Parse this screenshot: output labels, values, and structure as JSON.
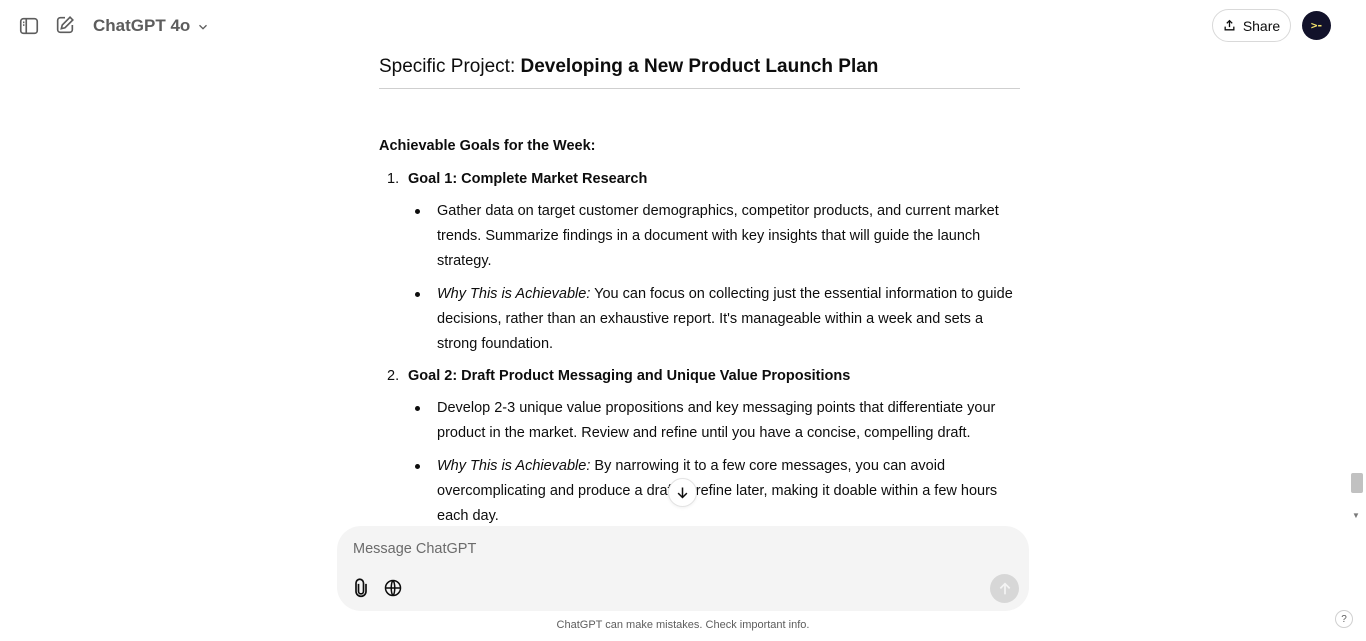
{
  "header": {
    "model_name": "ChatGPT 4o",
    "share_label": "Share",
    "avatar_text": ">-"
  },
  "content": {
    "heading_prefix": "Specific Project: ",
    "heading_bold": "Developing a New Product Launch Plan",
    "section_title": "Achievable Goals for the Week:",
    "goals": [
      {
        "number": "1.",
        "title": "Goal 1: Complete Market Research",
        "bullets": [
          {
            "lead": "",
            "text": "Gather data on target customer demographics, competitor products, and current market trends. Summarize findings in a document with key insights that will guide the launch strategy."
          },
          {
            "lead": "Why This is Achievable:",
            "text": " You can focus on collecting just the essential information to guide decisions, rather than an exhaustive report. It's manageable within a week and sets a strong foundation."
          }
        ]
      },
      {
        "number": "2.",
        "title": "Goal 2: Draft Product Messaging and Unique Value Propositions",
        "bullets": [
          {
            "lead": "",
            "text": "Develop 2-3 unique value propositions and key messaging points that differentiate your product in the market. Review and refine until you have a concise, compelling draft."
          },
          {
            "lead": "Why This is Achievable:",
            "text": " By narrowing it to a few core messages, you can avoid overcomplicating and produce a draft to refine later, making it doable within a few hours each day."
          }
        ]
      }
    ]
  },
  "composer": {
    "placeholder": "Message ChatGPT"
  },
  "footer": {
    "disclaimer": "ChatGPT can make mistakes. Check important info.",
    "help_label": "?"
  },
  "icons": {
    "sidebar_toggle": "sidebar-toggle-icon",
    "new_chat": "new-chat-icon",
    "chevron": "chevron-down-icon",
    "share": "share-icon",
    "attach": "paperclip-icon",
    "web": "globe-icon",
    "send": "arrow-up-icon",
    "scroll_down": "arrow-down-icon"
  },
  "colors": {
    "composer_bg": "#f4f4f4",
    "text": "#0d0d0d",
    "muted": "#5d5d5d"
  }
}
